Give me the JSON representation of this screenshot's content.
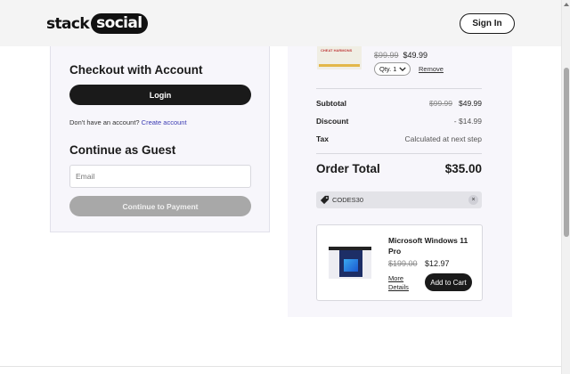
{
  "header": {
    "logo_part1": "stack",
    "logo_part2": "social",
    "signin_label": "Sign In"
  },
  "account": {
    "title": "Checkout with Account",
    "login_label": "Login",
    "no_account_text": "Don't have an account?",
    "create_account_label": "Create account"
  },
  "guest": {
    "title": "Continue as Guest",
    "email_placeholder": "Email",
    "continue_label": "Continue to Payment"
  },
  "cart_item": {
    "thumb_label": "CHEAT HARMONS",
    "old_price": "$99.99",
    "new_price": "$49.99",
    "qty_label": "Qty. 1",
    "remove_label": "Remove"
  },
  "summary": {
    "subtotal_label": "Subtotal",
    "subtotal_old": "$99.99",
    "subtotal_value": "$49.99",
    "discount_label": "Discount",
    "discount_value": "- $14.99",
    "tax_label": "Tax",
    "tax_value": "Calculated at next step",
    "total_label": "Order Total",
    "total_value": "$35.00"
  },
  "coupon": {
    "code": "CODES30",
    "remove_symbol": "×"
  },
  "upsell": {
    "title": "Microsoft Windows 11 Pro",
    "old_price": "$199.00",
    "new_price": "$12.97",
    "more_details_label": "More Details",
    "add_to_cart_label": "Add to Cart"
  },
  "colors": {
    "primary_button": "#1a1a1a",
    "disabled_button": "#a8a8a8",
    "link": "#3b3bb3",
    "panel_bg": "#f7f6fb"
  },
  "icons": [
    "tag-icon",
    "chevron-down-icon",
    "close-icon"
  ]
}
